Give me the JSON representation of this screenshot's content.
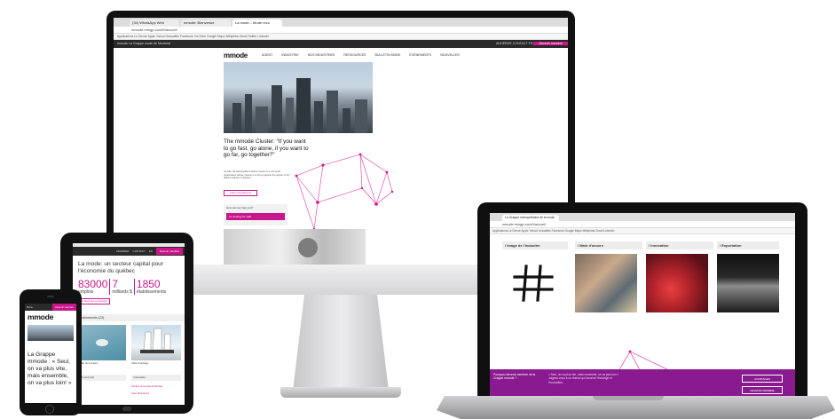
{
  "imac": {
    "tabs": [
      "(34) WhatsApp Web",
      "mmode: Bienvenue",
      "La mode – Mode rézo"
    ],
    "url": "mmode.mmgp.com/fr/accueil",
    "bookmarks": "Applications   Le Devoir   Apple   Yahoo!   Actualités   Facebook   YouTube   Google Maps   Wikipédia   Gmail   Twitter   LinkedIn",
    "strip_left": "mmode   La Grappe mode de Montréal",
    "strip_right": "ADHÉRER   CONTACT   FR",
    "strip_cta": "Devenir membre",
    "logo": "mmode",
    "nav": [
      "AGENT",
      "INDUSTRIE",
      "NOS INDUSTRIES",
      "RESSOURCES",
      "BULLETIN MODE",
      "ÉVÉNEMENTS",
      "NOUVELLES"
    ],
    "intro_heading": "The mmode Cluster: “If you want to go fast, go alone, if you want to go far, go together?”",
    "intro_para": "mmode, the Metropolitan Fashion Cluster is a non-profit organization whose mission is to bring together the players in the fashion industry of Quebec.",
    "intro_button": "Learn more about us",
    "help_label": "How can we help you?",
    "help_select": "I'm looking for staff"
  },
  "laptop": {
    "tab": "La Grappe métropolitaine de la mode",
    "url": "mmode.mmgp.com/fr/accueil",
    "bookmarks": "Applications   Le Devoir   Apple   Yahoo!   Actualités   Facebook   Google Maps   Wikipédia   Gmail   LinkedIn",
    "categories": [
      "/ Image de l'industrie",
      "/ Main d'oeuvre",
      "/ Innovation",
      "/ Exportation"
    ],
    "logo_glyph": "#/",
    "band_question": "Pourquoi devenir membre de la Grappe mmode ?",
    "band_answer": "« Seul, on va plus vite, mais ensemble, on va plus loin » Joignez-vous à un réseau qui favorise l'échange et l'innovation.",
    "band_buttons": [
      "AVANTAGES",
      "DEVENIR MEMBRE"
    ],
    "accent": "#8a1a8f"
  },
  "tablet": {
    "strip_items": [
      "ADHÉRER",
      "CONTACT",
      "FR"
    ],
    "strip_cta": "Devenir membre",
    "heading": "La mode: un secteur capital pour l'économie du québec",
    "stats": [
      {
        "num": "83000",
        "label": "emplois"
      },
      {
        "num": "7",
        "label": "milliards $"
      },
      {
        "num": "1850",
        "label": "établissements"
      }
    ],
    "button": "En savoir plus sur l'industrie",
    "events_bar": "/ Événements (23)",
    "captions": [
      "Atelier de formation",
      "Voiles d'Héritage"
    ],
    "col_heads": [
      "/ À venir (12)",
      "/ Nouvelles"
    ],
    "col_lines": [
      "Semaine de la mode de Montréal",
      "Salon Mode Export"
    ],
    "accent": "#c8168c"
  },
  "phone": {
    "strip_left": "Menu",
    "strip_cta": "Devenir membre",
    "logo": "mmode",
    "text": "La Grappe mmode : « Seul, on va plus vite, mais ensemble, on va plus loin! »"
  }
}
